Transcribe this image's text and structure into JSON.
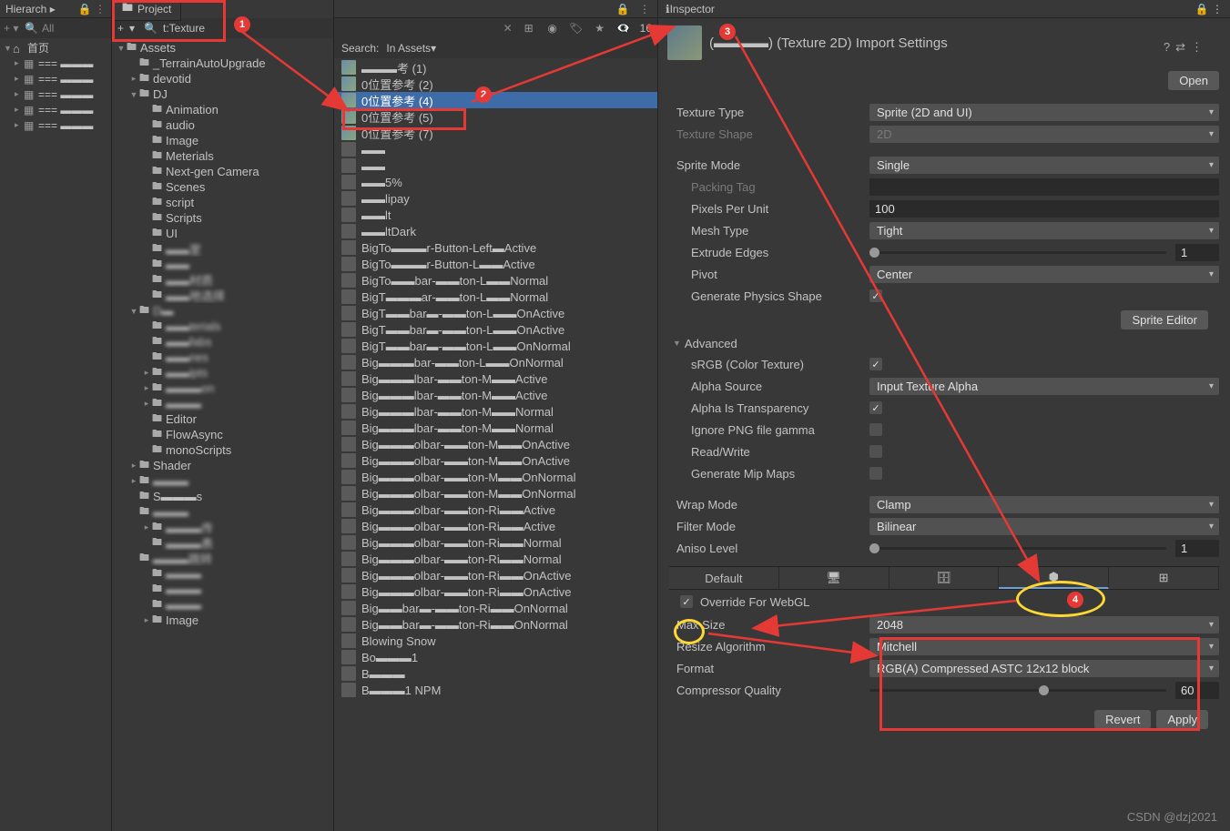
{
  "hierarchy": {
    "title": "Hierarch",
    "search": "All",
    "home": "首页",
    "rows": [
      "=== ▬▬▬",
      "=== ▬▬▬",
      "=== ▬▬▬",
      "=== ▬▬▬",
      "=== ▬▬▬"
    ]
  },
  "project": {
    "tab": "Project",
    "plus": "+",
    "search_text": "t:Texture",
    "assets": "Assets",
    "folders": {
      "terrain": "_TerrainAutoUpgrade",
      "devotid": "devotid",
      "dj": "DJ",
      "dj_children": [
        "Animation",
        "audio",
        "Image",
        "Meterials",
        "Next-gen Camera",
        "Scenes",
        "script",
        "Scripts",
        "UI",
        "▬▬室",
        "▬▬",
        "▬▬材质",
        "▬▬地选择"
      ],
      "d2": "D▬",
      "d2_children": [
        "▬▬terials",
        "▬▬fabs",
        "▬▬nes",
        "▬▬ipts",
        "▬▬▬on",
        "▬▬▬",
        "Editor",
        "FlowAsync",
        "monoScripts"
      ],
      "shader": "Shader",
      "misc": [
        "▬▬▬",
        "S▬▬▬s",
        "▬▬▬",
        "▬▬▬传",
        "▬▬▬表",
        "▬▬▬跳转",
        "▬▬▬",
        "▬▬▬",
        "▬▬▬",
        "Image"
      ]
    },
    "search_label": "Search:",
    "in_assets": "In Assets",
    "hidden_count": "16",
    "results": {
      "top": [
        "▬▬▬考 (1)",
        "0位置参考 (2)",
        "0位置参考 (4)",
        "0位置参考 (5)",
        "0位置参考 (7)"
      ],
      "selected_index": 2,
      "mid": [
        "▬▬",
        "▬▬",
        "▬▬5%",
        "▬▬lipay",
        "▬▬lt",
        "▬▬ltDark"
      ],
      "big": [
        "BigTo▬▬▬r-Button-Left▬Active",
        "BigTo▬▬▬r-Button-L▬▬Active",
        "BigTo▬▬bar-▬▬ton-L▬▬Normal",
        "BigT▬▬▬ar-▬▬ton-L▬▬Normal",
        "BigT▬▬bar▬-▬▬ton-L▬▬OnActive",
        "BigT▬▬bar▬-▬▬ton-L▬▬OnActive",
        "BigT▬▬bar▬-▬▬ton-L▬▬OnNormal",
        "Big▬▬▬bar-▬▬ton-L▬▬OnNormal",
        "Big▬▬▬lbar-▬▬ton-M▬▬Active",
        "Big▬▬▬lbar-▬▬ton-M▬▬Active",
        "Big▬▬▬lbar-▬▬ton-M▬▬Normal",
        "Big▬▬▬lbar-▬▬ton-M▬▬Normal",
        "Big▬▬▬olbar-▬▬ton-M▬▬OnActive",
        "Big▬▬▬olbar-▬▬ton-M▬▬OnActive",
        "Big▬▬▬olbar-▬▬ton-M▬▬OnNormal",
        "Big▬▬▬olbar-▬▬ton-M▬▬OnNormal",
        "Big▬▬▬olbar-▬▬ton-Ri▬▬Active",
        "Big▬▬▬olbar-▬▬ton-Ri▬▬Active",
        "Big▬▬▬olbar-▬▬ton-Ri▬▬Normal",
        "Big▬▬▬olbar-▬▬ton-Ri▬▬Normal",
        "Big▬▬▬olbar-▬▬ton-Ri▬▬OnActive",
        "Big▬▬▬olbar-▬▬ton-Ri▬▬OnActive",
        "Big▬▬bar▬-▬▬ton-Ri▬▬OnNormal",
        "Big▬▬bar▬-▬▬ton-Ri▬▬OnNormal",
        "Blowing Snow",
        "Bo▬▬▬1",
        "B▬▬▬",
        "B▬▬▬1 NPM"
      ]
    }
  },
  "inspector": {
    "title": "Inspector",
    "asset_title": "(▬▬▬▬) (Texture 2D) Import Settings",
    "open": "Open",
    "texture_type": {
      "label": "Texture Type",
      "value": "Sprite (2D and UI)"
    },
    "texture_shape": {
      "label": "Texture Shape",
      "value": "2D"
    },
    "sprite_mode": {
      "label": "Sprite Mode",
      "value": "Single"
    },
    "packing_tag": "Packing Tag",
    "ppu": {
      "label": "Pixels Per Unit",
      "value": "100"
    },
    "mesh_type": {
      "label": "Mesh Type",
      "value": "Tight"
    },
    "extrude": {
      "label": "Extrude Edges",
      "value": "1"
    },
    "pivot": {
      "label": "Pivot",
      "value": "Center"
    },
    "gen_physics": "Generate Physics Shape",
    "sprite_editor": "Sprite Editor",
    "advanced": "Advanced",
    "srgb": "sRGB (Color Texture)",
    "alpha_source": {
      "label": "Alpha Source",
      "value": "Input Texture Alpha"
    },
    "alpha_trans": "Alpha Is Transparency",
    "ignore_gamma": "Ignore PNG file gamma",
    "read_write": "Read/Write",
    "gen_mipmaps": "Generate Mip Maps",
    "wrap_mode": {
      "label": "Wrap Mode",
      "value": "Clamp"
    },
    "filter_mode": {
      "label": "Filter Mode",
      "value": "Bilinear"
    },
    "aniso": {
      "label": "Aniso Level",
      "value": "1"
    },
    "default_tab": "Default",
    "override": "Override For WebGL",
    "max_size": {
      "label": "Max Size",
      "value": "2048"
    },
    "resize_algo": {
      "label": "Resize Algorithm",
      "value": "Mitchell"
    },
    "format": {
      "label": "Format",
      "value": "RGB(A) Compressed ASTC 12x12 block"
    },
    "comp_quality": {
      "label": "Compressor Quality",
      "value": "60"
    },
    "revert": "Revert",
    "apply": "Apply"
  },
  "badges": {
    "b1": "1",
    "b2": "2",
    "b3": "3",
    "b4": "4"
  },
  "watermark": "CSDN @dzj2021"
}
